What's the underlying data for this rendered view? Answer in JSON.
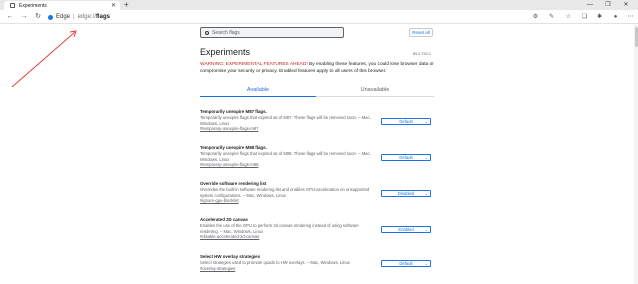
{
  "browser": {
    "tab_title": "Experiments",
    "tab_close": "✕",
    "new_tab": "+",
    "win_min": "—",
    "win_max": "❐",
    "win_close": "✕",
    "nav_back": "←",
    "nav_forward": "→",
    "nav_reload": "↻",
    "brand": "Edge",
    "separator": "|",
    "url_scheme": "edge://",
    "url_host": "flags",
    "toolbar_icons": [
      "settings-icon",
      "pen-icon",
      "favorites-icon",
      "collections-icon",
      "extensions-icon",
      "profile-icon",
      "more-icon"
    ]
  },
  "page": {
    "search_placeholder": "Search flags",
    "reset_label": "Reset all",
    "title": "Experiments",
    "version": "89.0.752.1",
    "warning_prefix": "WARNING: EXPERIMENTAL FEATURES AHEAD!",
    "warning_body": " By enabling these features, you could lose browser data or compromise your security or privacy. Enabled features apply to all users of this browser.",
    "tab_available": "Available",
    "tab_unavailable": "Unavailable"
  },
  "flags": [
    {
      "name": "Temporarily unexpire M87 flags.",
      "desc": "Temporarily unexpire flags that expired as of M87. These flags will be removed soon. – Mac, Windows, Linux",
      "link": "#temporary-unexpire-flags-m87",
      "value": "Default"
    },
    {
      "name": "Temporarily unexpire M88 flags.",
      "desc": "Temporarily unexpire flags that expired as of M88. These flags will be removed soon. – Mac, Windows, Linux",
      "link": "#temporary-unexpire-flags-m88",
      "value": "Default"
    },
    {
      "name": "Override software rendering list",
      "desc": "Overrides the built-in software rendering list and enables GPU-acceleration on unsupported system configurations. – Mac, Windows, Linux",
      "link": "#ignore-gpu-blocklist",
      "value": "Disabled"
    },
    {
      "name": "Accelerated 2D canvas",
      "desc": "Enables the use of the GPU to perform 2d canvas rendering instead of using software rendering. – Mac, Windows, Linux",
      "link": "#disable-accelerated-2d-canvas",
      "value": "Enabled"
    },
    {
      "name": "Select HW overlay strategies",
      "desc": "Select strategies used to promote quads to HW overlays. – Mac, Windows, Linux",
      "link": "#overlay-strategies",
      "value": "Default"
    }
  ],
  "colors": {
    "accent": "#1a73e8",
    "warning_red": "#c5221f",
    "annotation_arrow": "#e53935"
  }
}
